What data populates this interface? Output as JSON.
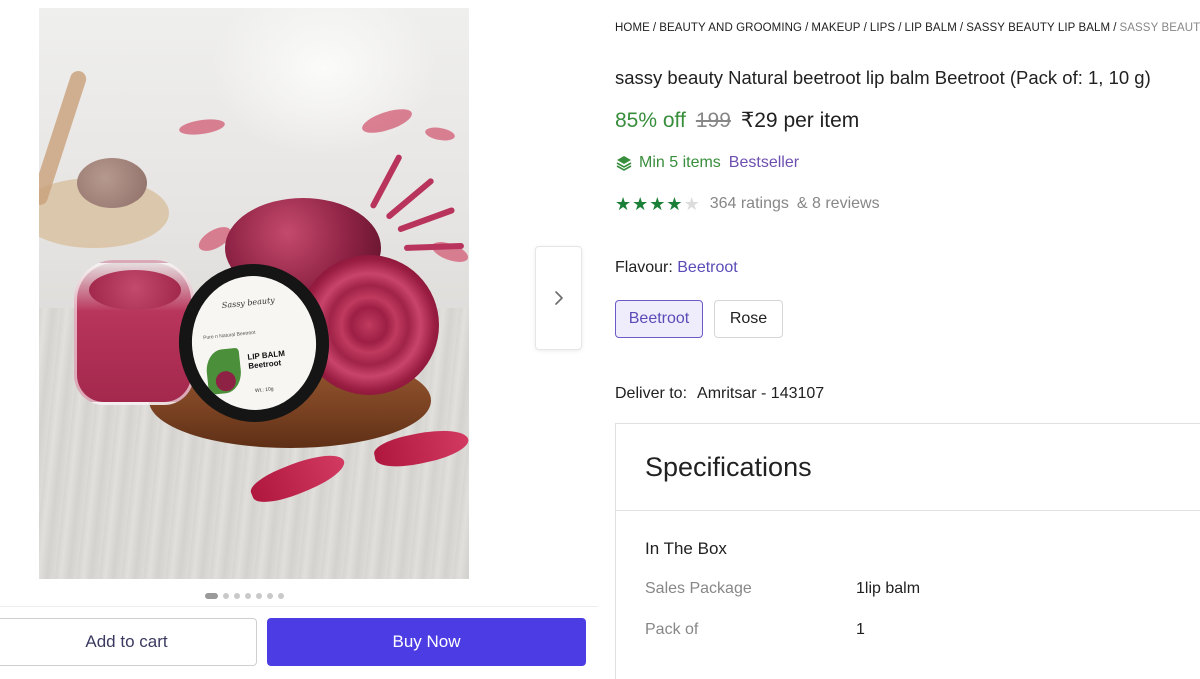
{
  "breadcrumb": [
    "HOME",
    "BEAUTY AND GROOMING",
    "MAKEUP",
    "LIPS",
    "LIP BALM",
    "SASSY BEAUTY LIP BALM",
    "SASSY BEAUTY NATURAL BEETROOT LIP BALM"
  ],
  "product": {
    "title": "sassy beauty Natural beetroot lip balm Beetroot (Pack of: 1, 10 g)",
    "discount": "85% off",
    "mrp": "199",
    "price": "₹29 per item",
    "min_items": "Min 5 items",
    "badge": "Bestseller",
    "rating_value": 4,
    "rating_max": 5,
    "ratings_count": "364 ratings",
    "reviews_count": "& 8 reviews"
  },
  "image": {
    "label_brand": "Sassy beauty",
    "label_line": "Pure n Natural Beetroot",
    "label_title": "LIP BALM",
    "label_subtitle": "Beetroot",
    "label_weight": "Wt.: 10g",
    "gallery_count": 7,
    "gallery_active": 0
  },
  "flavour": {
    "label": "Flavour:",
    "selected": "Beetroot",
    "options": [
      "Beetroot",
      "Rose"
    ]
  },
  "delivery": {
    "label": "Deliver to:",
    "location": "Amritsar - 143107"
  },
  "specifications": {
    "title": "Specifications",
    "group": "In The Box",
    "rows": [
      {
        "key": "Sales Package",
        "value": "1lip balm"
      },
      {
        "key": "Pack of",
        "value": "1"
      }
    ]
  },
  "actions": {
    "add_to_cart": "Add to cart",
    "buy_now": "Buy Now"
  },
  "colors": {
    "accent": "#4c3ce4",
    "discount_green": "#388e3c",
    "star_green": "#1a7f37",
    "variant_purple": "#5b4bb8"
  },
  "icons": {
    "next": "chevron-right-icon",
    "min_items": "layers-icon",
    "stars": "star-icon"
  }
}
